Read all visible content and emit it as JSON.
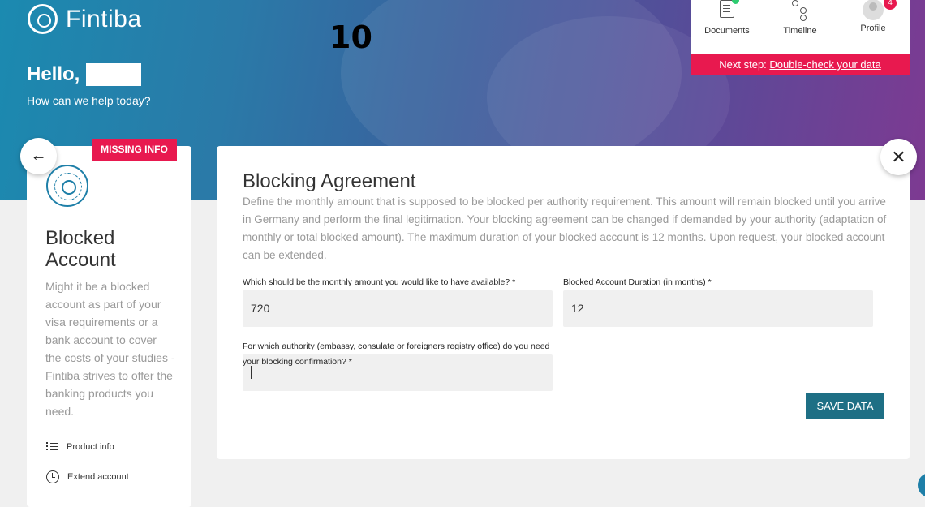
{
  "brand": {
    "name": "Fintiba"
  },
  "overlay_step": "10",
  "header": {
    "greeting": "Hello,",
    "subtitle": "How can we help today?"
  },
  "topnav": {
    "items": [
      {
        "label": "Documents"
      },
      {
        "label": "Timeline"
      },
      {
        "label": "Profile",
        "badge": "4"
      }
    ],
    "next_step_prefix": "Next step:",
    "next_step_link": "Double-check your data"
  },
  "sidebar": {
    "missing_badge": "MISSING INFO",
    "title": "Blocked Account",
    "description": "Might it be a blocked account as part of your visa requirements or a bank account to cover the costs of your studies - Fintiba strives to offer the banking products you need.",
    "links": [
      {
        "label": "Product info"
      },
      {
        "label": "Extend account"
      }
    ]
  },
  "form": {
    "title": "Blocking Agreement",
    "description": "Define the monthly amount that is supposed to be blocked per authority requirement. This amount will remain blocked until you arrive in Germany and perform the final legitimation. Your blocking agreement can be changed if demanded by your authority (adaptation of monthly or total blocked amount). The maximum duration of your blocked account is 12 months. Upon request, your blocked account can be extended.",
    "monthly_label": "Which should be the monthly amount you would like to have available? *",
    "monthly_value": "720",
    "duration_label": "Blocked Account Duration (in months) *",
    "duration_value": "12",
    "authority_label": "For which authority (embassy, consulate or foreigners registry office) do you need your blocking confirmation? *",
    "authority_value": "",
    "save_label": "SAVE DATA"
  },
  "colors": {
    "accent": "#e8194f",
    "primary": "#1e6f85"
  }
}
